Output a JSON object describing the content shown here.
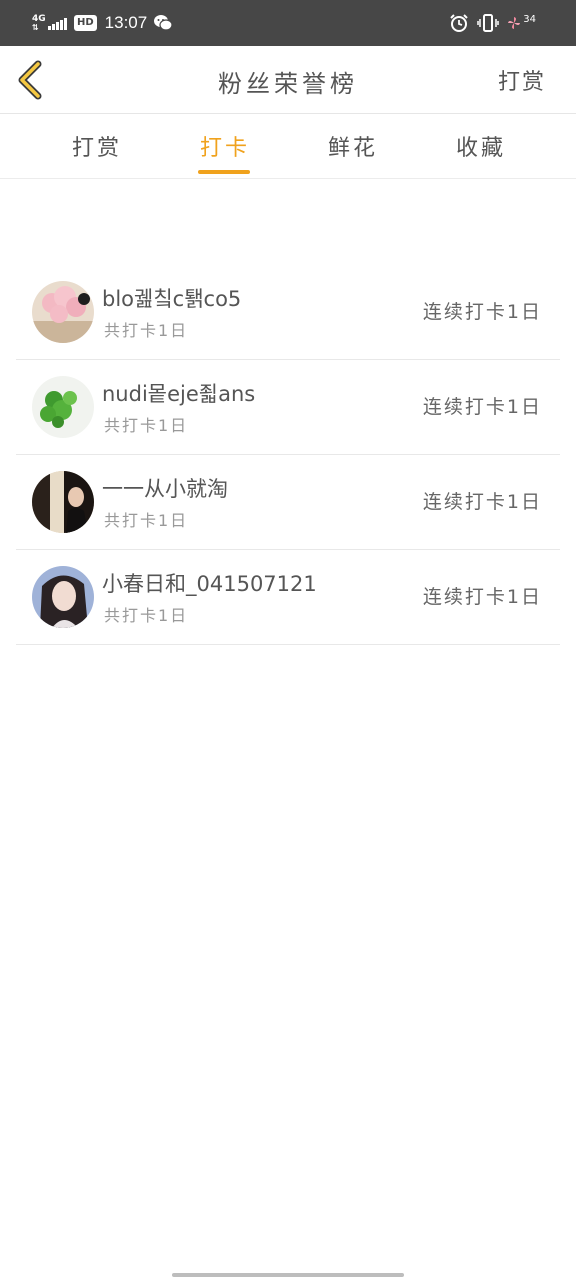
{
  "status_bar": {
    "network": "4G",
    "hd": "HD",
    "time": "13:07",
    "battery": "34"
  },
  "header": {
    "title": "粉丝荣誉榜",
    "action": "打赏"
  },
  "tabs": [
    {
      "label": "打赏",
      "active": false
    },
    {
      "label": "打卡",
      "active": true
    },
    {
      "label": "鲜花",
      "active": false
    },
    {
      "label": "收藏",
      "active": false
    }
  ],
  "fans": [
    {
      "name": "blo궲칰c퇡co5",
      "sub": "共打卡1日",
      "streak": "连续打卡1日"
    },
    {
      "name": "nudi뫁eje죏ans",
      "sub": "共打卡1日",
      "streak": "连续打卡1日"
    },
    {
      "name": "一一从小就淘",
      "sub": "共打卡1日",
      "streak": "连续打卡1日"
    },
    {
      "name": "小春日和_041507121",
      "sub": "共打卡1日",
      "streak": "连续打卡1日"
    }
  ],
  "colors": {
    "accent": "#f0a21d",
    "status_bar": "#474747",
    "text": "#555555",
    "subtext": "#999999"
  }
}
